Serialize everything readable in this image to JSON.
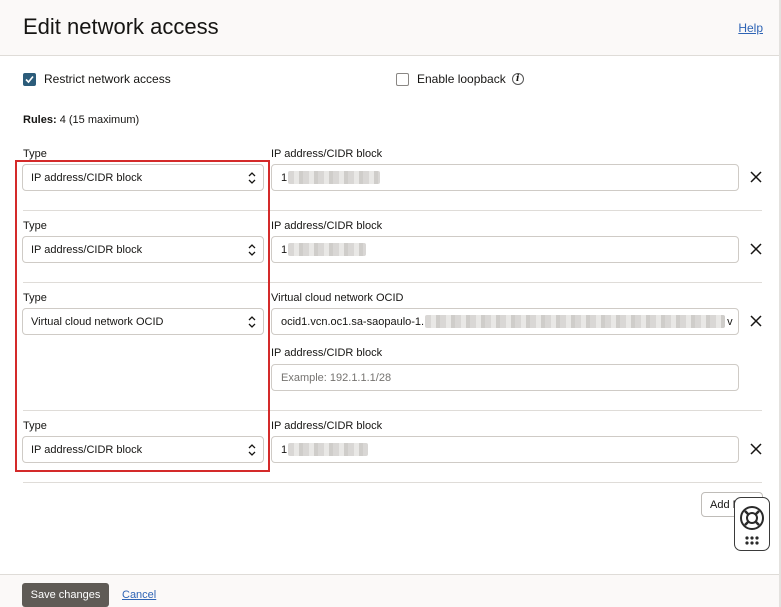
{
  "header": {
    "title": "Edit network access",
    "help_label": "Help"
  },
  "options": {
    "restrict_label": "Restrict network access",
    "restrict_checked": true,
    "loopback_label": "Enable loopback",
    "loopback_checked": false,
    "info_icon": "info-icon"
  },
  "rules_summary": {
    "label": "Rules:",
    "value": "4 (15 maximum)"
  },
  "rules": [
    {
      "type_label": "Type",
      "type_value": "IP address/CIDR block",
      "field_label": "IP address/CIDR block",
      "field_value": "1"
    },
    {
      "type_label": "Type",
      "type_value": "IP address/CIDR block",
      "field_label": "IP address/CIDR block",
      "field_value": "1"
    },
    {
      "type_label": "Type",
      "type_value": "Virtual cloud network OCID",
      "field_label": "Virtual cloud network OCID",
      "field_value": "ocid1.vcn.oc1.sa-saopaulo-1.",
      "field_value_tail": "v",
      "extra_label": "IP address/CIDR block",
      "extra_placeholder": "Example: 192.1.1.1/28"
    },
    {
      "type_label": "Type",
      "type_value": "IP address/CIDR block",
      "field_label": "IP address/CIDR block",
      "field_value": "1"
    }
  ],
  "add_button_label": "Add R",
  "footer": {
    "save_label": "Save changes",
    "cancel_label": "Cancel"
  },
  "colors": {
    "highlight": "#d42a2a",
    "primary_button": "#5f5b56",
    "link": "#2e64b5",
    "checkbox": "#2c5c7a"
  }
}
